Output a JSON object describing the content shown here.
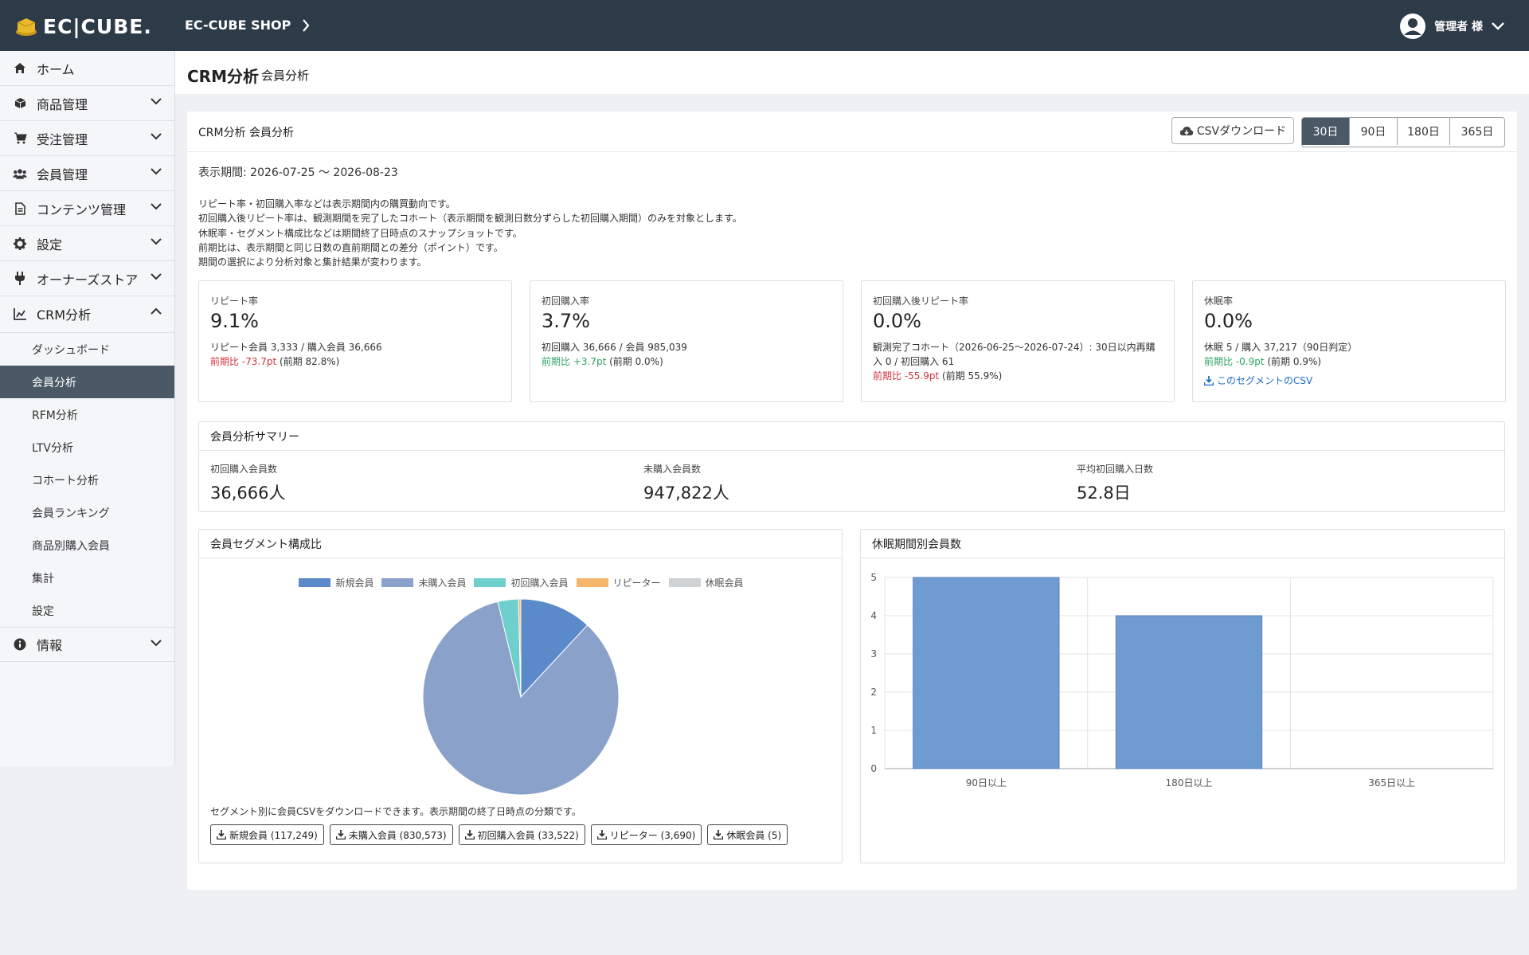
{
  "header": {
    "logo_text": "EC|CUBE.",
    "shop_name": "EC-CUBE SHOP",
    "user_name": "管理者 様"
  },
  "sidebar": {
    "items": [
      {
        "label": "ホーム",
        "icon": "home-icon",
        "has_arrow": false
      },
      {
        "label": "商品管理",
        "icon": "cube-icon",
        "has_arrow": true
      },
      {
        "label": "受注管理",
        "icon": "cart-icon",
        "has_arrow": true
      },
      {
        "label": "会員管理",
        "icon": "users-icon",
        "has_arrow": true
      },
      {
        "label": "コンテンツ管理",
        "icon": "document-icon",
        "has_arrow": true
      },
      {
        "label": "設定",
        "icon": "gear-icon",
        "has_arrow": true
      },
      {
        "label": "オーナーズストア",
        "icon": "plug-icon",
        "has_arrow": true
      },
      {
        "label": "CRM分析",
        "icon": "chart-icon",
        "has_arrow": true,
        "expanded": true
      }
    ],
    "crm_sub": [
      {
        "label": "ダッシュボード",
        "active": false
      },
      {
        "label": "会員分析",
        "active": true
      },
      {
        "label": "RFM分析",
        "active": false
      },
      {
        "label": "LTV分析",
        "active": false
      },
      {
        "label": "コホート分析",
        "active": false
      },
      {
        "label": "会員ランキング",
        "active": false
      },
      {
        "label": "商品別購入会員",
        "active": false
      },
      {
        "label": "集計",
        "active": false
      },
      {
        "label": "設定",
        "active": false
      }
    ],
    "info": {
      "label": "情報",
      "icon": "info-icon"
    }
  },
  "page": {
    "title": "CRM分析",
    "subtitle": "会員分析"
  },
  "card": {
    "title": "CRM分析 会員分析",
    "csv_label": "CSVダウンロード",
    "periods": [
      {
        "label": "30日",
        "active": true
      },
      {
        "label": "90日",
        "active": false
      },
      {
        "label": "180日",
        "active": false
      },
      {
        "label": "365日",
        "active": false
      }
    ],
    "range": "表示期間: 2026-07-25 〜 2026-08-23",
    "notes": [
      "リピート率・初回購入率などは表示期間内の購買動向です。",
      "初回購入後リピート率は、観測期間を完了したコホート（表示期間を観測日数分ずらした初回購入期間）のみを対象とします。",
      "休眠率・セグメント構成比などは期間終了日時点のスナップショットです。",
      "前期比は、表示期間と同じ日数の直前期間との差分（ポイント）です。",
      "期間の選択により分析対象と集計結果が変わります。"
    ]
  },
  "kpis": [
    {
      "label": "リピート率",
      "value": "9.1%",
      "detail": "リピート会員 3,333 / 購入会員 36,666",
      "change": "前期比 -73.7pt",
      "change_color": "red",
      "prev": " (前期 82.8%)"
    },
    {
      "label": "初回購入率",
      "value": "3.7%",
      "detail": "初回購入 36,666 / 会員 985,039",
      "change": "前期比 +3.7pt",
      "change_color": "green",
      "prev": " (前期 0.0%)"
    },
    {
      "label": "初回購入後リピート率",
      "value": "0.0%",
      "detail": "観測完了コホート（2026-06-25〜2026-07-24）: 30日以内再購入 0 / 初回購入 61",
      "change": "前期比 -55.9pt",
      "change_color": "red",
      "prev": " (前期 55.9%)"
    },
    {
      "label": "休眠率",
      "value": "0.0%",
      "detail": "休眠 5 / 購入 37,217（90日判定）",
      "change": "前期比 -0.9pt",
      "change_color": "green",
      "prev": " (前期 0.9%)",
      "link": "このセグメントのCSV"
    }
  ],
  "summary": {
    "title": "会員分析サマリー",
    "items": [
      {
        "label": "初回購入会員数",
        "value": "36,666人"
      },
      {
        "label": "未購入会員数",
        "value": "947,822人"
      },
      {
        "label": "平均初回購入日数",
        "value": "52.8日"
      }
    ]
  },
  "segment": {
    "title": "会員セグメント構成比",
    "note": "セグメント別に会員CSVをダウンロードできます。表示期間の終了日時点の分類です。",
    "buttons": [
      "新規会員 (117,249)",
      "未購入会員 (830,573)",
      "初回購入会員 (33,522)",
      "リピーター (3,690)",
      "休眠会員 (5)"
    ]
  },
  "dormant": {
    "title": "休眠期間別会員数"
  },
  "chart_data": [
    {
      "type": "pie",
      "categories": [
        "新規会員",
        "未購入会員",
        "初回購入会員",
        "リピーター",
        "休眠会員"
      ],
      "values": [
        117249,
        830573,
        33522,
        3690,
        5
      ],
      "colors": [
        "#5b8acb",
        "#8aa1c9",
        "#6fcfcc",
        "#f5b56b",
        "#d0d3d6"
      ],
      "legend": "top"
    },
    {
      "type": "bar",
      "categories": [
        "90日以上",
        "180日以上",
        "365日以上"
      ],
      "values": [
        5,
        4,
        0
      ],
      "yticks": [
        "0",
        "1",
        "2",
        "3",
        "4",
        "5"
      ],
      "ylim": [
        0,
        5
      ],
      "color": "#6f9bd1",
      "grid": true
    }
  ]
}
